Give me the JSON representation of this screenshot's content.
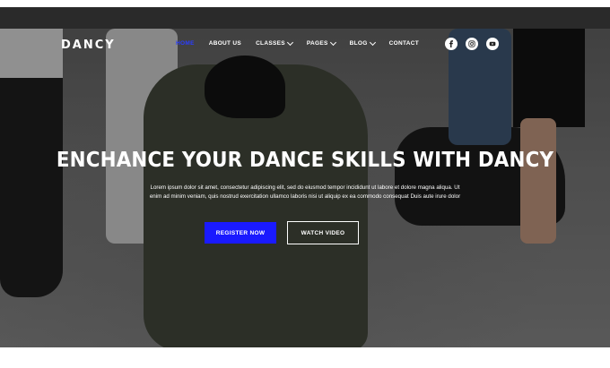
{
  "brand": {
    "logo": "DANCY",
    "accent_color": "#1a1aff"
  },
  "nav": {
    "items": [
      {
        "label": "HOME",
        "active": true
      },
      {
        "label": "ABOUT US"
      },
      {
        "label": "CLASSES",
        "dropdown": true
      },
      {
        "label": "PAGES",
        "dropdown": true
      },
      {
        "label": "BLOG",
        "dropdown": true
      },
      {
        "label": "CONTACT"
      }
    ]
  },
  "social": {
    "icons": [
      "facebook-icon",
      "instagram-icon",
      "youtube-icon"
    ]
  },
  "hero": {
    "headline": "ENCHANCE YOUR DANCE SKILLS WITH DANCY",
    "paragraph": "Lorem ipsum dolor sit amet, consectetur adipiscing elit, sed do eiusmod tempor incididunt ut labore et dolore magna aliqua. Ut enim ad minim veniam, quis nostrud exercitation ullamco laboris nisi ut aliquip ex ea commodo consequat Duis aute irure dolor",
    "primary_button": "REGISTER NOW",
    "secondary_button": "WATCH VIDEO"
  }
}
